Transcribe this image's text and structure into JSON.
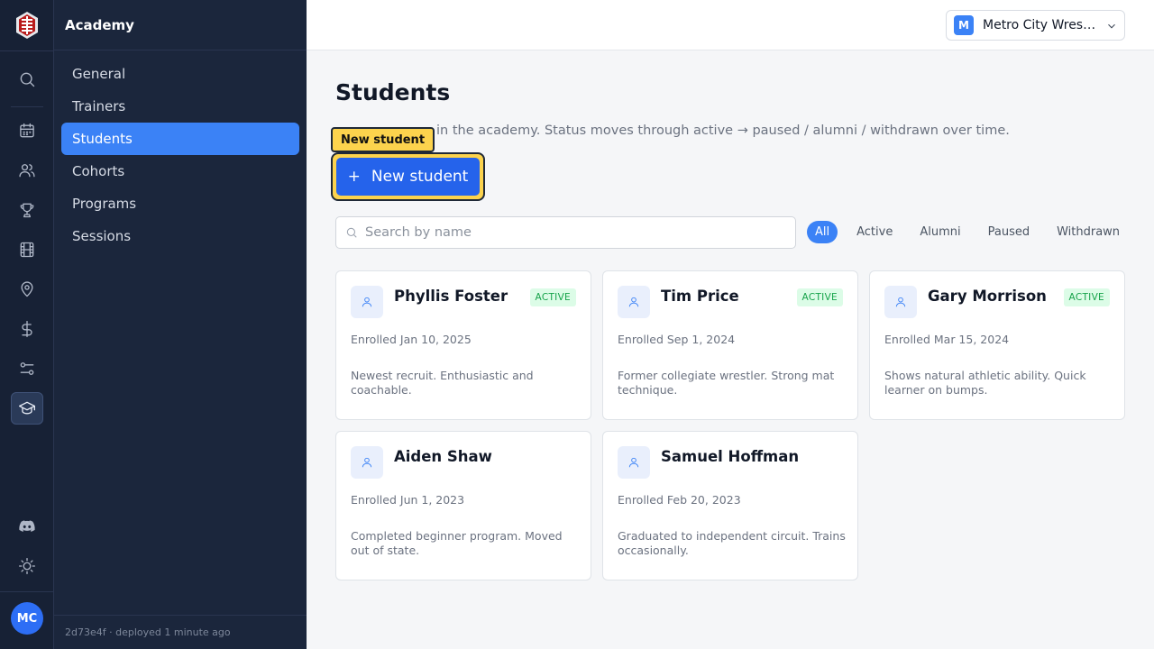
{
  "rail": {
    "items": [
      "search-icon",
      "calendar-icon",
      "users-icon",
      "trophy-icon",
      "film-icon",
      "map-pin-icon",
      "dollar-icon",
      "sliders-icon",
      "graduation-cap-icon"
    ],
    "active": "graduation-cap-icon",
    "bottom": [
      "discord-icon",
      "sun-icon"
    ],
    "avatar_initials": "MC"
  },
  "sidebar": {
    "title": "Academy",
    "items": [
      {
        "label": "General"
      },
      {
        "label": "Trainers"
      },
      {
        "label": "Students"
      },
      {
        "label": "Cohorts"
      },
      {
        "label": "Programs"
      },
      {
        "label": "Sessions"
      }
    ],
    "active_index": 2,
    "footer": "2d73e4f  · deployed 1 minute ago"
  },
  "topbar": {
    "org_initial": "M",
    "org_name": "Metro City Wrestling"
  },
  "page": {
    "title": "Students",
    "description": "in the academy. Status moves through active → paused / alumni / withdrawn over time.",
    "tooltip": "New student",
    "new_button_icon": "+",
    "new_button_label": "New student",
    "search_placeholder": "Search by name",
    "filters": [
      {
        "label": "All"
      },
      {
        "label": "Active"
      },
      {
        "label": "Alumni"
      },
      {
        "label": "Paused"
      },
      {
        "label": "Withdrawn"
      }
    ],
    "active_filter": 0
  },
  "students": [
    {
      "name": "Phyllis Foster",
      "status": "ACTIVE",
      "enrolled": "Enrolled Jan 10, 2025",
      "note": "Newest recruit. Enthusiastic and coachable."
    },
    {
      "name": "Tim Price",
      "status": "ACTIVE",
      "enrolled": "Enrolled Sep 1, 2024",
      "note": "Former collegiate wrestler. Strong mat technique."
    },
    {
      "name": "Gary Morrison",
      "status": "ACTIVE",
      "enrolled": "Enrolled Mar 15, 2024",
      "note": "Shows natural athletic ability. Quick learner on bumps."
    },
    {
      "name": "Aiden Shaw",
      "status": "",
      "enrolled": "Enrolled Jun 1, 2023",
      "note": "Completed beginner program. Moved out of state."
    },
    {
      "name": "Samuel Hoffman",
      "status": "",
      "enrolled": "Enrolled Feb 20, 2023",
      "note": "Graduated to independent circuit. Trains occasionally."
    }
  ],
  "colors": {
    "accent": "#3b82f6",
    "rail_bg": "#172135",
    "sidebar_bg": "#1b263c",
    "tooltip": "#fcd34d",
    "active_badge_bg": "#dcfce7",
    "active_badge_text": "#16a34a"
  }
}
